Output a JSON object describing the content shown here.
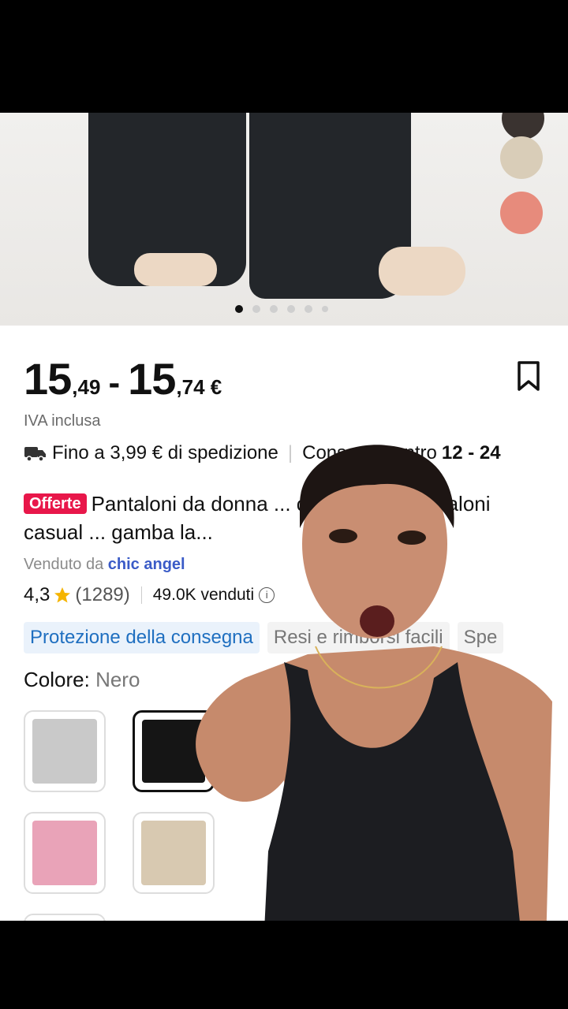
{
  "product": {
    "price_from_int": "15",
    "price_from_dec": ",49",
    "price_to_int": "15",
    "price_to_dec": ",74 €",
    "price_separator": "-",
    "vat_note": "IVA inclusa",
    "shipping_text": "Fino a 3,99 € di spedizione",
    "delivery_text": "Consegna entro",
    "delivery_days": "12 - 24",
    "offer_badge": "Offerte",
    "title": "Pantaloni da donna ... con tasche, pantaloni casual ... gamba la...",
    "seller_prefix": "Venduto da",
    "seller_name": "chic angel",
    "rating": "4,3",
    "rating_count": "(1289)",
    "sold": "49.0K venduti",
    "tags": [
      "Protezione della consegna",
      "Resi e rimborsi facili",
      "Spe"
    ],
    "color_label": "Colore:",
    "color_value": "Nero",
    "carousel_pages": 6,
    "carousel_active": 1
  },
  "colors": {
    "accent_red": "#e8174a",
    "link_blue": "#3a5bc7",
    "tag_blue": "#1f6fc0",
    "swatches": [
      "#c9c9c9",
      "#151515",
      "#e9a3b8",
      "#d8c9b1"
    ],
    "hero_swatches": [
      "#3a3330",
      "#d9cdb8",
      "#e78b7c"
    ]
  },
  "icons": [
    "bookmark-icon",
    "truck-icon",
    "star-icon",
    "info-icon"
  ]
}
